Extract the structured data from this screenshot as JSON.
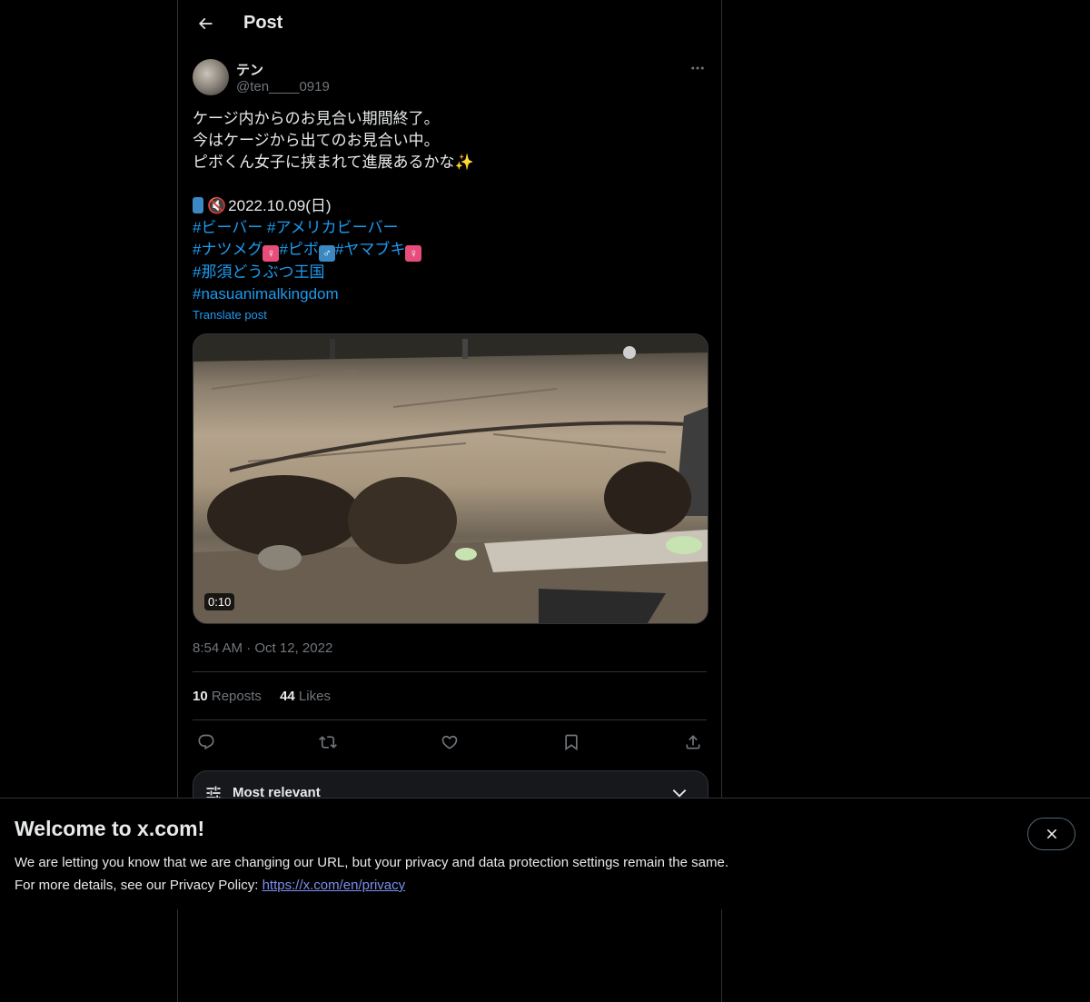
{
  "header": {
    "title": "Post",
    "back_icon": "arrow-left-icon"
  },
  "author": {
    "display_name": "テン",
    "handle": "@ten____0919"
  },
  "tweet": {
    "lines": [
      "ケージ内からのお見合い期間終了。",
      "今はケージから出てのお見合い中。",
      "ピボくん女子に挟まれて進展あるかな"
    ],
    "sparkle": "✨",
    "date_line": "2022.10.09(日)",
    "hashtags_1": [
      "#ビーバー",
      "#アメリカビーバー"
    ],
    "hashtags_2": [
      "#ナツメグ",
      "#ピボ",
      "#ヤマブキ"
    ],
    "hashtags_3": [
      "#那須どうぶつ王国"
    ],
    "hashtags_4": [
      "#nasuanimalkingdom"
    ],
    "female_sign": "♀",
    "male_sign": "♂",
    "translate": "Translate post"
  },
  "media": {
    "duration": "0:10"
  },
  "meta": {
    "time": "8:54 AM",
    "sep": "·",
    "date": "Oct 12, 2022"
  },
  "stats": {
    "reposts_count": "10",
    "reposts_label": "Reposts",
    "likes_count": "44",
    "likes_label": "Likes"
  },
  "actions": [
    "reply-icon",
    "repost-icon",
    "like-icon",
    "bookmark-icon",
    "share-icon"
  ],
  "replies_filter": {
    "label": "Most relevant"
  },
  "banner": {
    "title": "Welcome to x.com!",
    "line1": "We are letting you know that we are changing our URL, but your privacy and data protection settings remain the same.",
    "line2_prefix": "For more details, see our Privacy Policy: ",
    "link": "https://x.com/en/privacy"
  },
  "colors": {
    "accent": "#1d9bf0",
    "background": "#000000",
    "muted": "#71767b",
    "text": "#e7e9ea"
  }
}
